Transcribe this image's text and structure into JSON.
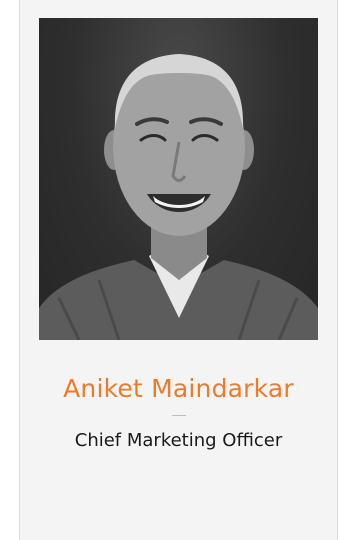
{
  "profile": {
    "name": "Aniket Maindarkar",
    "title": "Chief Marketing Officer",
    "photo_icon": "person-portrait"
  },
  "colors": {
    "name_accent": "#f07a2a",
    "card_background": "#f4f4f4",
    "photo_background": "#2e2e2e",
    "title_text": "#1a1a1a"
  }
}
